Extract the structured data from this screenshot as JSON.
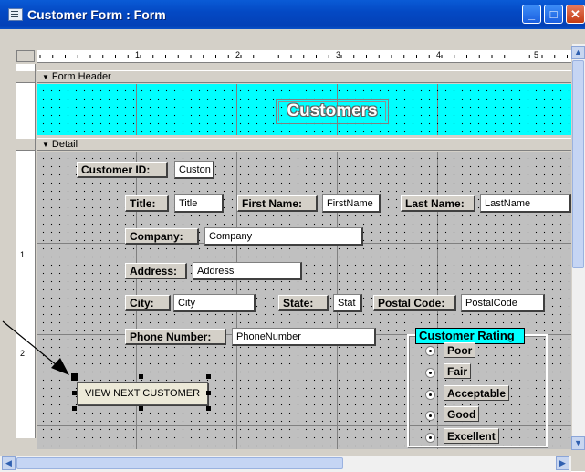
{
  "window": {
    "title": "Customer Form : Form"
  },
  "sections": {
    "header_label": "Form Header",
    "detail_label": "Detail"
  },
  "ruler": {
    "marks": [
      "1",
      "2",
      "3",
      "4",
      "5"
    ],
    "vmarks": [
      "1",
      "2"
    ]
  },
  "header": {
    "title": "Customers"
  },
  "fields": {
    "customer_id": {
      "label": "Customer ID:",
      "value": "Custon"
    },
    "title": {
      "label": "Title:",
      "value": "Title"
    },
    "first_name": {
      "label": "First Name:",
      "value": "FirstName"
    },
    "last_name": {
      "label": "Last Name:",
      "value": "LastName"
    },
    "company": {
      "label": "Company:",
      "value": "Company"
    },
    "address": {
      "label": "Address:",
      "value": "Address"
    },
    "city": {
      "label": "City:",
      "value": "City"
    },
    "state": {
      "label": "State:",
      "value": "Stat"
    },
    "postal_code": {
      "label": "Postal Code:",
      "value": "PostalCode"
    },
    "phone_number": {
      "label": "Phone Number:",
      "value": "PhoneNumber"
    }
  },
  "rating": {
    "label": "Customer Rating",
    "options": [
      "Poor",
      "Fair",
      "Acceptable",
      "Good",
      "Excellent"
    ]
  },
  "button": {
    "label": "VIEW NEXT CUSTOMER"
  },
  "colors": {
    "header_bg": "#00ffff",
    "titlebar": "#0449c4",
    "grid": "#c0c0c0"
  },
  "icons": {
    "app": "form-icon",
    "minimize": "minimize-icon",
    "maximize": "maximize-icon",
    "close": "close-icon"
  }
}
